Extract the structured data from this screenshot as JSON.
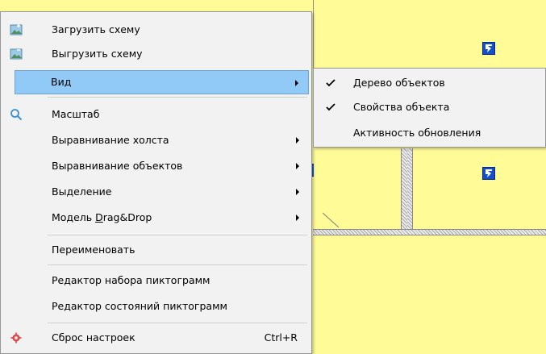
{
  "menu": {
    "items": [
      {
        "label": "Загрузить схему",
        "icon": "image-load-icon"
      },
      {
        "label": "Выгрузить схему",
        "icon": "image-save-icon"
      },
      {
        "label": "Вид",
        "submenu": true,
        "highlighted": true
      },
      {
        "label": "Масштаб",
        "icon": "magnifier-icon"
      },
      {
        "label": "Выравнивание холста",
        "submenu": true
      },
      {
        "label": "Выравнивание объектов",
        "submenu": true
      },
      {
        "label": "Выделение",
        "submenu": true
      },
      {
        "label_prefix": "Модель ",
        "label_underlined": "D",
        "label_suffix": "rag&Drop",
        "submenu": true
      },
      {
        "label": "Переименовать"
      },
      {
        "label": "Редактор набора пиктограмм"
      },
      {
        "label": "Редактор состояний пиктограмм"
      },
      {
        "label": "Сброс настроек",
        "shortcut": "Ctrl+R",
        "icon": "gear-icon"
      }
    ]
  },
  "submenu": {
    "items": [
      {
        "label": "Дерево объектов",
        "checked": true
      },
      {
        "label": "Свойства объекта",
        "checked": true
      },
      {
        "label": "Активность обновления",
        "checked": false
      }
    ]
  },
  "colors": {
    "canvas": "#fffb96",
    "highlight": "#91c9f7",
    "status_icon": "#1550c8"
  }
}
